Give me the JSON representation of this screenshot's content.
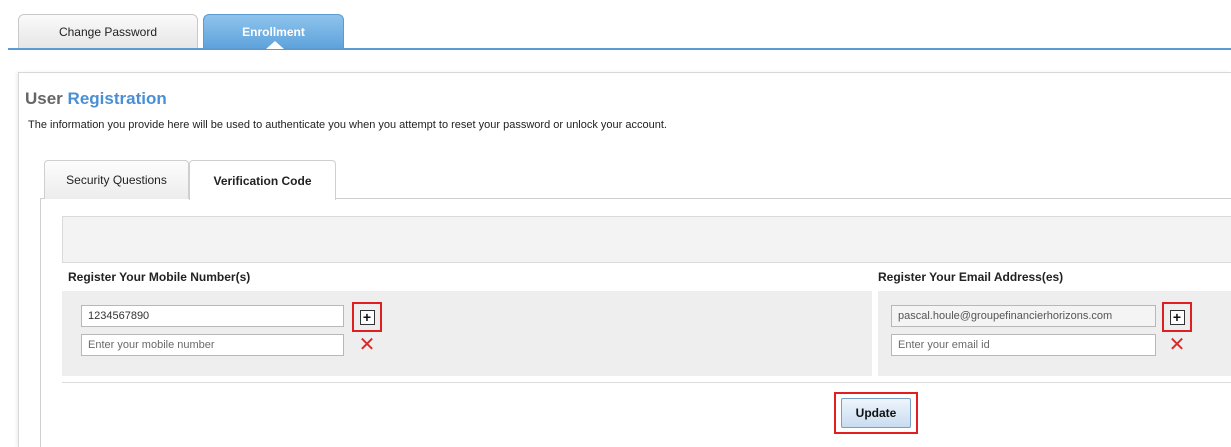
{
  "top_tabs": [
    {
      "label": "Change Password",
      "active": false
    },
    {
      "label": "Enrollment",
      "active": true
    }
  ],
  "registration": {
    "title_prefix": "User",
    "title_highlight": "Registration",
    "description": "The information you provide here will be used to authenticate you when you attempt to reset your password or unlock your account."
  },
  "inner_tabs": [
    {
      "label": "Security Questions",
      "active": false
    },
    {
      "label": "Verification Code",
      "active": true
    }
  ],
  "mobile": {
    "section_label": "Register Your Mobile Number(s)",
    "numbers": [
      "1234567890"
    ],
    "new_placeholder": "Enter your mobile number"
  },
  "email": {
    "section_label": "Register Your Email Address(es)",
    "addresses": [
      "pascal.houle@groupefinancierhorizons.com"
    ],
    "new_placeholder": "Enter your email id"
  },
  "actions": {
    "update_label": "Update",
    "add_icon": "plus-icon",
    "remove_icon": "close-icon"
  },
  "colors": {
    "accent": "#5b9bd5",
    "highlight_border": "#e02020",
    "remove": "#d92b2b"
  }
}
